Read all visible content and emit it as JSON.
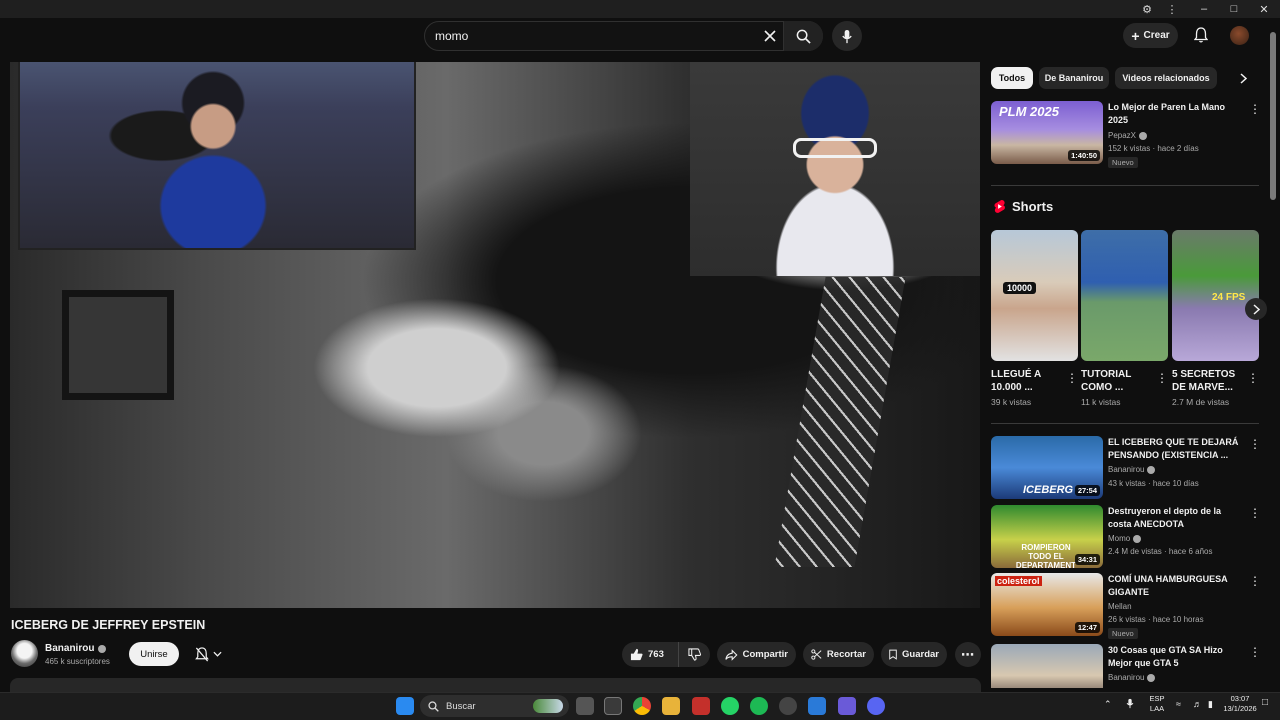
{
  "search": {
    "value": "momo"
  },
  "masthead": {
    "create_label": "Crear"
  },
  "video": {
    "title": "ICEBERG DE JEFFREY EPSTEIN",
    "channel": "Bananirou",
    "subscribers": "465 k suscriptores",
    "join_label": "Unirse",
    "likes": "763",
    "share_label": "Compartir",
    "clip_label": "Recortar",
    "save_label": "Guardar"
  },
  "chips": [
    "Todos",
    "De Bananirou",
    "Videos relacionados"
  ],
  "recommendations_top": {
    "title": "Lo Mejor de Paren La Mano 2025",
    "channel": "PepazX",
    "meta": "152 k vistas · hace 2 días",
    "badge": "Nuevo",
    "duration": "1:40:50",
    "thumb_text": "PLM 2025"
  },
  "shorts": {
    "header": "Shorts",
    "items": [
      {
        "title": "LLEGUÉ A 10.000 ...",
        "views": "39 k vistas",
        "thumb_text": "10000"
      },
      {
        "title": "TUTORIAL COMO ...",
        "views": "11 k vistas",
        "thumb_text": ""
      },
      {
        "title": "5 SECRETOS DE MARVE...",
        "views": "2.7 M de vistas",
        "thumb_text": "24 FPS"
      }
    ]
  },
  "recommendations": [
    {
      "title": "EL ICEBERG QUE TE DEJARÁ PENSANDO (EXISTENCIA ...",
      "channel": "Bananirou",
      "meta": "43 k vistas · hace 10 días",
      "badge": "",
      "duration": "27:54",
      "thumb_text": "ICEBERG"
    },
    {
      "title": "Destruyeron el depto de la costa ANECDOTA",
      "channel": "Momo",
      "meta": "2.4 M de vistas · hace 6 años",
      "badge": "",
      "duration": "34:31",
      "thumb_text": "ROMPIERON TODO EL DEPARTAMENT"
    },
    {
      "title": "COMÍ UNA HAMBURGUESA GIGANTE",
      "channel": "Mellan",
      "meta": "26 k vistas · hace 10 horas",
      "badge": "Nuevo",
      "duration": "12:47",
      "thumb_text": "colesterol"
    },
    {
      "title": "30 Cosas que GTA SA Hizo Mejor que GTA 5",
      "channel": "Bananirou",
      "meta": "",
      "badge": "",
      "duration": "",
      "thumb_text": ""
    }
  ],
  "taskbar": {
    "search_label": "Buscar",
    "lang_line1": "ESP",
    "lang_line2": "LAA",
    "time": "03:07",
    "date": "13/1/2026"
  },
  "colors": {
    "background": "#0f0f0f",
    "chip_bg": "#272727",
    "text_secondary": "#aaaaaa",
    "shorts_red": "#ff0033"
  }
}
